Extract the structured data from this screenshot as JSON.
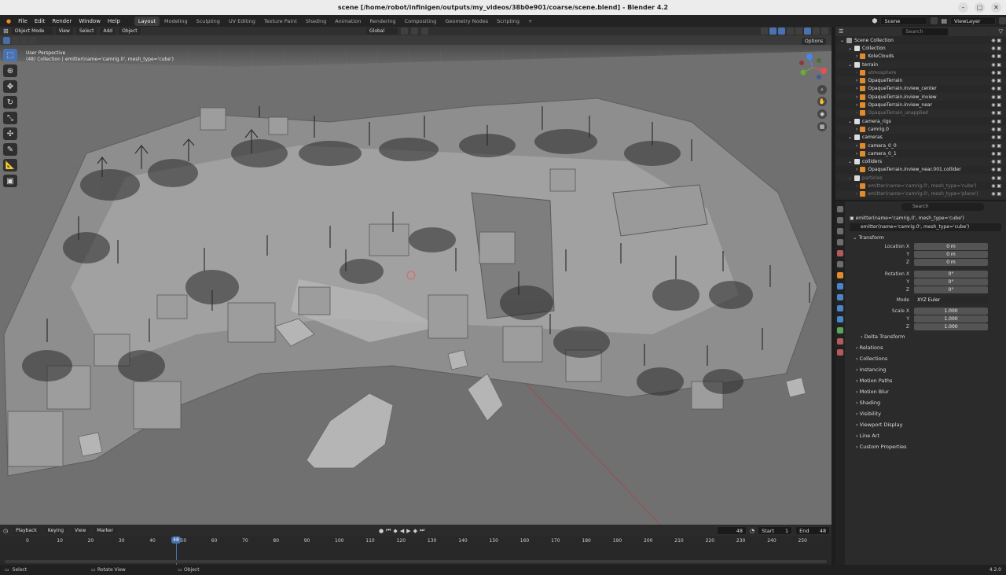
{
  "window": {
    "title": "scene [/home/robot/infinigen/outputs/my_videos/38b0e901/coarse/scene.blend] - Blender 4.2"
  },
  "menu": [
    "File",
    "Edit",
    "Render",
    "Window",
    "Help"
  ],
  "workspaces": [
    "Layout",
    "Modeling",
    "Sculpting",
    "UV Editing",
    "Texture Paint",
    "Shading",
    "Animation",
    "Rendering",
    "Compositing",
    "Geometry Nodes",
    "Scripting"
  ],
  "active_workspace": "Layout",
  "scene": {
    "name": "Scene",
    "view_layer": "ViewLayer"
  },
  "viewport": {
    "mode": "Object Mode",
    "menus": [
      "View",
      "Select",
      "Add",
      "Object"
    ],
    "orientation": "Global",
    "options_label": "Options",
    "overlay_line1": "User Perspective",
    "overlay_line2": "(48) Collection | emitter(name='camrig.0', mesh_type='cube')"
  },
  "outliner": {
    "search_placeholder": "Search",
    "rows": [
      {
        "name": "Scene Collection",
        "kind": "scene",
        "indent": 0
      },
      {
        "name": "Collection",
        "kind": "collection",
        "indent": 1
      },
      {
        "name": "KoleClouds",
        "kind": "object",
        "indent": 2
      },
      {
        "name": "terrain",
        "kind": "collection",
        "indent": 1
      },
      {
        "name": "atmosphere",
        "kind": "object",
        "indent": 2,
        "dim": true
      },
      {
        "name": "OpaqueTerrain",
        "kind": "object",
        "indent": 2
      },
      {
        "name": "OpaqueTerrain.inview_center",
        "kind": "object",
        "indent": 2
      },
      {
        "name": "OpaqueTerrain.inview_inview",
        "kind": "object",
        "indent": 2
      },
      {
        "name": "OpaqueTerrain.inview_near",
        "kind": "object",
        "indent": 2
      },
      {
        "name": "OpaqueTerrain_unapplied",
        "kind": "object",
        "indent": 2,
        "dim": true
      },
      {
        "name": "camera_rigs",
        "kind": "collection",
        "indent": 1
      },
      {
        "name": "camrig.0",
        "kind": "object",
        "indent": 2
      },
      {
        "name": "cameras",
        "kind": "collection",
        "indent": 1
      },
      {
        "name": "camera_0_0",
        "kind": "object",
        "indent": 2
      },
      {
        "name": "camera_0_1",
        "kind": "object",
        "indent": 2
      },
      {
        "name": "colliders",
        "kind": "collection",
        "indent": 1
      },
      {
        "name": "OpaqueTerrain.inview_near.001.collider",
        "kind": "object",
        "indent": 2
      },
      {
        "name": "particles",
        "kind": "collection",
        "indent": 1,
        "dim": true
      },
      {
        "name": "emitter(name='camrig.0', mesh_type='cube')",
        "kind": "object",
        "indent": 2,
        "dim": true
      },
      {
        "name": "emitter(name='camrig.0', mesh_type='plane')",
        "kind": "object",
        "indent": 2,
        "dim": true
      }
    ]
  },
  "properties": {
    "search_placeholder": "Search",
    "object_line": "emitter(name='camrig.0', mesh_type='cube')",
    "object_name": "emitter(name='camrig.0', mesh_type='cube')",
    "transform_label": "Transform",
    "location": {
      "label": "Location X",
      "y": "Y",
      "z": "Z",
      "x_val": "0 m",
      "y_val": "0 m",
      "z_val": "0 m"
    },
    "rotation": {
      "label": "Rotation X",
      "y": "Y",
      "z": "Z",
      "x_val": "0°",
      "y_val": "0°",
      "z_val": "0°"
    },
    "mode": {
      "label": "Mode",
      "value": "XYZ Euler"
    },
    "scale": {
      "label": "Scale X",
      "y": "Y",
      "z": "Z",
      "x_val": "1.000",
      "y_val": "1.000",
      "z_val": "1.000"
    },
    "delta_transform": "Delta Transform",
    "sections": [
      "Relations",
      "Collections",
      "Instancing",
      "Motion Paths",
      "Motion Blur",
      "Shading",
      "Visibility",
      "Viewport Display",
      "Line Art",
      "Custom Properties"
    ]
  },
  "timeline": {
    "menus": [
      "Playback",
      "Keying",
      "View",
      "Marker"
    ],
    "current_frame": "48",
    "start_label": "Start",
    "start": "1",
    "end_label": "End",
    "end": "48",
    "ticks": [
      "0",
      "10",
      "20",
      "30",
      "40",
      "50",
      "60",
      "70",
      "80",
      "90",
      "100",
      "110",
      "120",
      "130",
      "140",
      "150",
      "160",
      "170",
      "180",
      "190",
      "200",
      "210",
      "220",
      "230",
      "240",
      "250"
    ]
  },
  "status": {
    "select": "Select",
    "rotate": "Rotate View",
    "object": "Object",
    "version": "4.2.0"
  }
}
